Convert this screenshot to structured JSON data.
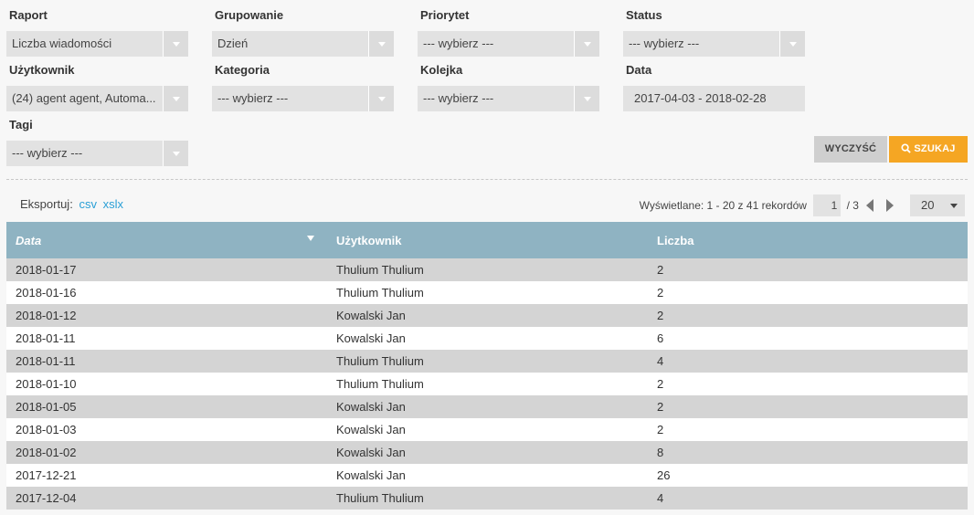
{
  "filters": {
    "report": {
      "label": "Raport",
      "value": "Liczba wiadomości"
    },
    "grouping": {
      "label": "Grupowanie",
      "value": "Dzień"
    },
    "priority": {
      "label": "Priorytet",
      "value": "--- wybierz ---"
    },
    "status": {
      "label": "Status",
      "value": "--- wybierz ---"
    },
    "user": {
      "label": "Użytkownik",
      "value": "(24) agent agent, Automa..."
    },
    "category": {
      "label": "Kategoria",
      "value": "--- wybierz ---"
    },
    "queue": {
      "label": "Kolejka",
      "value": "--- wybierz ---"
    },
    "date": {
      "label": "Data",
      "value": "2017-04-03 - 2018-02-28"
    },
    "tags": {
      "label": "Tagi",
      "value": "--- wybierz ---"
    }
  },
  "buttons": {
    "clear": "WYCZYŚĆ",
    "search": "SZUKAJ"
  },
  "export": {
    "label": "Eksportuj:",
    "csv": "csv",
    "xslx": "xslx"
  },
  "pager": {
    "summary": "Wyświetlane: 1 - 20 z 41 rekordów",
    "current_page": "1",
    "total_pages": "/ 3",
    "per_page": "20"
  },
  "table": {
    "headers": [
      "Data",
      "Użytkownik",
      "Liczba"
    ],
    "rows": [
      [
        "2018-01-17",
        "Thulium Thulium",
        "2"
      ],
      [
        "2018-01-16",
        "Thulium Thulium",
        "2"
      ],
      [
        "2018-01-12",
        "Kowalski Jan",
        "2"
      ],
      [
        "2018-01-11",
        "Kowalski Jan",
        "6"
      ],
      [
        "2018-01-11",
        "Thulium Thulium",
        "4"
      ],
      [
        "2018-01-10",
        "Thulium Thulium",
        "2"
      ],
      [
        "2018-01-05",
        "Kowalski Jan",
        "2"
      ],
      [
        "2018-01-03",
        "Kowalski Jan",
        "2"
      ],
      [
        "2018-01-02",
        "Kowalski Jan",
        "8"
      ],
      [
        "2017-12-21",
        "Kowalski Jan",
        "26"
      ],
      [
        "2017-12-04",
        "Thulium Thulium",
        "4"
      ]
    ]
  },
  "colors": {
    "accent": "#f5a623",
    "table_header": "#8fb3c2",
    "link": "#2a9fd6"
  }
}
